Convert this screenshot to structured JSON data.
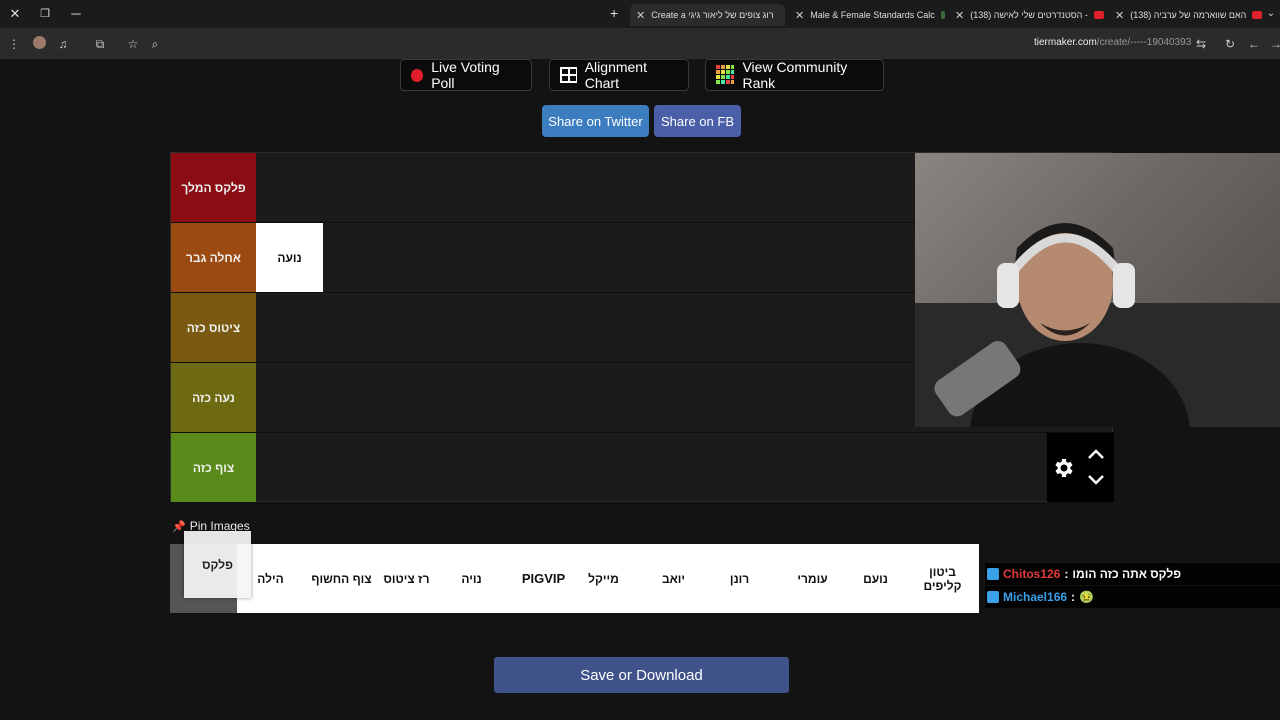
{
  "browser": {
    "tabs": [
      {
        "label": "Create a רוג צופים של ליאור גיגי",
        "active": true
      },
      {
        "label": "Male & Female Standards Calc",
        "active": false
      },
      {
        "label": "(138) הסטנדרטים שלי לאישה -",
        "active": false
      },
      {
        "label": "(138) האם שווארמה של ערביה",
        "active": false
      }
    ],
    "url_host": "tiermaker.com",
    "url_path": "/create/-----19040393"
  },
  "toolbar_buttons": {
    "live_voting": "Live Voting Poll",
    "alignment_chart": "Alignment Chart",
    "community_rank": "View Community Rank",
    "share_twitter": "Share on Twitter",
    "share_fb": "Share on FB"
  },
  "tiers": [
    {
      "label": "פלקס המלך",
      "color": "#8b0d14",
      "items": []
    },
    {
      "label": "אחלה גבר",
      "color": "#9b4a12",
      "items": [
        "נועה"
      ]
    },
    {
      "label": "ציטוס כזה",
      "color": "#7a5a10",
      "items": []
    },
    {
      "label": "נעה כזה",
      "color": "#6d6a12",
      "items": []
    },
    {
      "label": "צוף כזה",
      "color": "#5a8a1a",
      "items": []
    }
  ],
  "pin_label": "Pin Images",
  "pool_items": [
    "ביטון קליפים",
    "נועם",
    "עומרי",
    "רונן",
    "יואב",
    "מייקל",
    "PIGVIP",
    "נויה",
    "רז ציטוס",
    "צוף החשוף",
    "הילה"
  ],
  "dragging_item": "פלקס",
  "chat": [
    {
      "user": "Chitos126",
      "user_color": "#e23b3b",
      "message": "פלקס אתה כזה הומו"
    },
    {
      "user": "Michael166",
      "user_color": "#3aa0e8",
      "message": "🤢"
    }
  ],
  "save_button": "Save or Download"
}
